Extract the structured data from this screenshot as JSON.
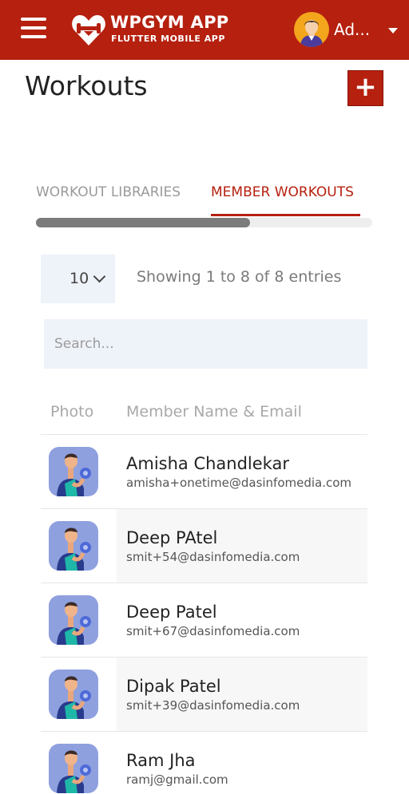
{
  "header": {
    "app_name": "WPGYM APP",
    "app_tagline": "FLUTTER MOBILE APP",
    "user_name": "Ad...",
    "icons": [
      "menu-icon",
      "heart-logo-icon",
      "user-avatar-icon",
      "caret-down-icon"
    ]
  },
  "page": {
    "title": "Workouts",
    "add_label": "+"
  },
  "tabs": [
    {
      "label": "WORKOUT LIBRARIES",
      "active": false
    },
    {
      "label": "MEMBER WORKOUTS",
      "active": true
    }
  ],
  "table_controls": {
    "page_length": "10",
    "info": "Showing 1 to 8 of 8 entries",
    "search_placeholder": "Search..."
  },
  "table": {
    "columns": [
      "Photo",
      "Member Name & Email"
    ],
    "rows": [
      {
        "name": "Amisha Chandlekar",
        "email": "amisha+onetime@dasinfomedia.com"
      },
      {
        "name": "Deep PAtel",
        "email": "smit+54@dasinfomedia.com"
      },
      {
        "name": "Deep Patel",
        "email": "smit+67@dasinfomedia.com"
      },
      {
        "name": "Dipak Patel",
        "email": "smit+39@dasinfomedia.com"
      },
      {
        "name": "Ram Jha",
        "email": "ramj@gmail.com"
      }
    ]
  },
  "colors": {
    "brand": "#b5200f",
    "avatar_bg": "#f3a51c",
    "photo_bg": "#8ea0de",
    "field_bg": "#eef2f9"
  }
}
